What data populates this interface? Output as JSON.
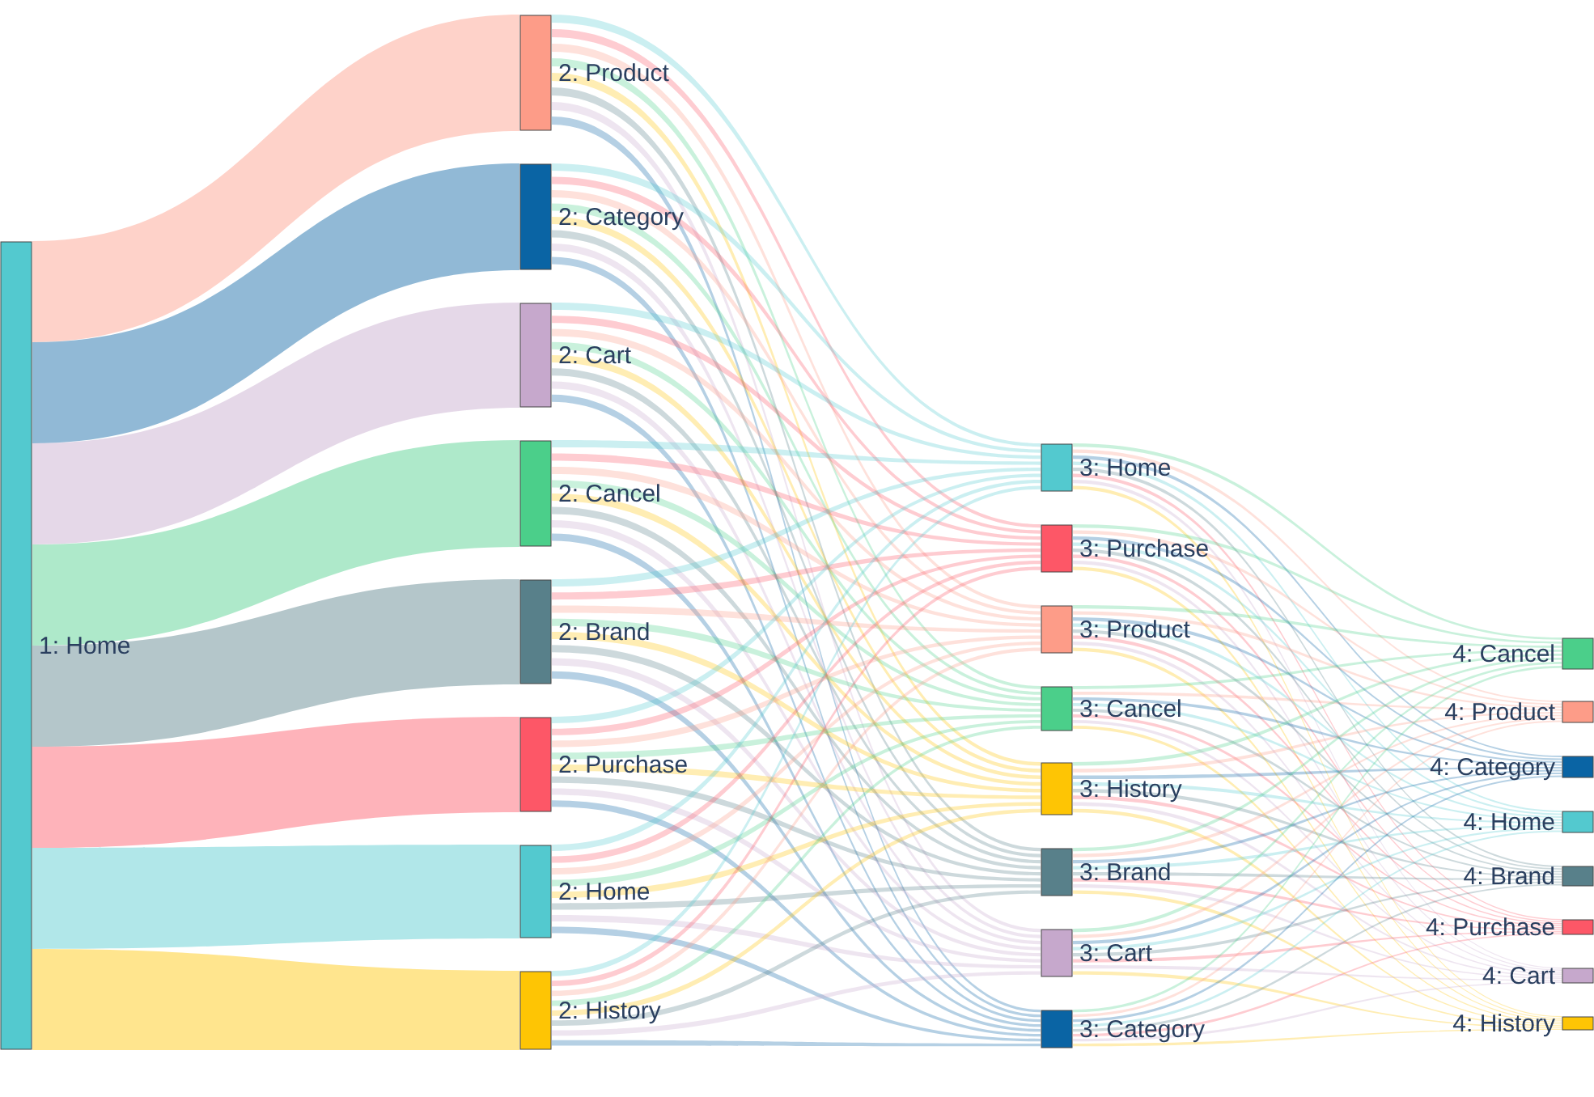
{
  "stages": [
    {
      "nodes": [
        {
          "label": "1: Home",
          "color": "#53c9cf"
        }
      ]
    },
    {
      "nodes": [
        {
          "label": "2: Product",
          "color": "#fd9c88"
        },
        {
          "label": "2: Category",
          "color": "#0a64a4"
        },
        {
          "label": "2: Cart",
          "color": "#c6a8cc"
        },
        {
          "label": "2: Cancel",
          "color": "#4bcf8a"
        },
        {
          "label": "2: Brand",
          "color": "#58808a"
        },
        {
          "label": "2: Purchase",
          "color": "#fd5767"
        },
        {
          "label": "2: Home",
          "color": "#53c9cf"
        },
        {
          "label": "2: History",
          "color": "#fec504"
        }
      ]
    },
    {
      "nodes": [
        {
          "label": "3: Home",
          "color": "#53c9cf"
        },
        {
          "label": "3: Purchase",
          "color": "#fd5767"
        },
        {
          "label": "3: Product",
          "color": "#fd9c88"
        },
        {
          "label": "3: Cancel",
          "color": "#4bcf8a"
        },
        {
          "label": "3: History",
          "color": "#fec504"
        },
        {
          "label": "3: Brand",
          "color": "#58808a"
        },
        {
          "label": "3: Cart",
          "color": "#c6a8cc"
        },
        {
          "label": "3: Category",
          "color": "#0a64a4"
        }
      ]
    },
    {
      "nodes": [
        {
          "label": "4: Cancel",
          "color": "#4bcf8a"
        },
        {
          "label": "4: Product",
          "color": "#fd9c88"
        },
        {
          "label": "4: Category",
          "color": "#0a64a4"
        },
        {
          "label": "4: Home",
          "color": "#53c9cf"
        },
        {
          "label": "4: Brand",
          "color": "#58808a"
        },
        {
          "label": "4: Purchase",
          "color": "#fd5767"
        },
        {
          "label": "4: Cart",
          "color": "#c6a8cc"
        },
        {
          "label": "4: History",
          "color": "#fec504"
        }
      ]
    }
  ]
}
